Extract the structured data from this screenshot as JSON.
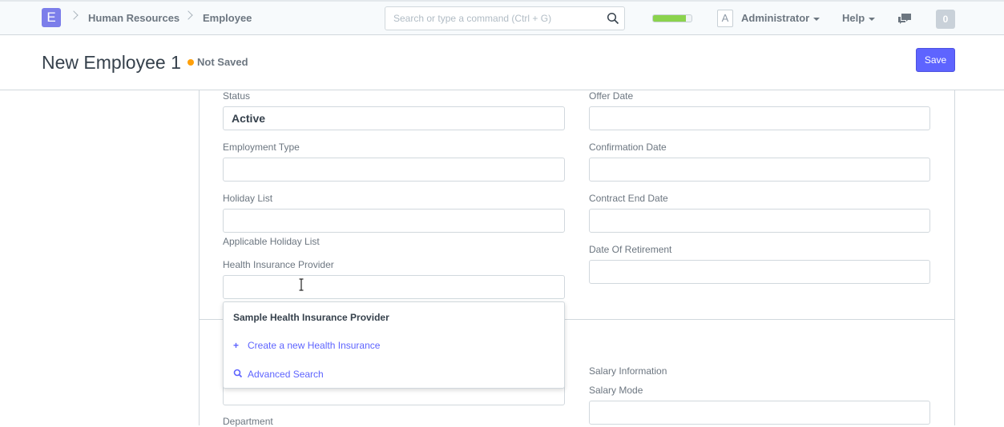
{
  "navbar": {
    "logo_letter": "E",
    "breadcrumbs": [
      "Human Resources",
      "Employee"
    ],
    "search_placeholder": "Search or type a command (Ctrl + G)",
    "progress_fraction": 0.85,
    "progress_color": "#8bd34d",
    "avatar_letter": "A",
    "user_label": "Administrator",
    "help_label": "Help",
    "notification_count": "0"
  },
  "page": {
    "title": "New Employee 1",
    "status": "Not Saved",
    "status_color": "#ffa00a",
    "save_label": "Save"
  },
  "form": {
    "left": [
      {
        "label": "Status",
        "value": "Active"
      },
      {
        "label": "Employment Type",
        "value": ""
      },
      {
        "label": "Holiday List",
        "value": ""
      },
      {
        "label": "Health Insurance Provider",
        "value": ""
      }
    ],
    "holiday_list_help": "Applicable Holiday List",
    "right": [
      {
        "label": "Offer Date",
        "value": ""
      },
      {
        "label": "Confirmation Date",
        "value": ""
      },
      {
        "label": "Contract End Date",
        "value": ""
      },
      {
        "label": "Date Of Retirement",
        "value": ""
      }
    ],
    "salary_section": "Salary Information",
    "salary_mode_label": "Salary Mode",
    "department_label": "Department"
  },
  "dropdown": {
    "option": "Sample Health Insurance Provider",
    "create_label": "Create a new Health Insurance",
    "advanced_label": "Advanced Search"
  },
  "icons": [
    "search-icon",
    "chat-icon",
    "chevron-right-icon",
    "plus-icon",
    "magnifier-icon",
    "text-cursor-icon"
  ]
}
